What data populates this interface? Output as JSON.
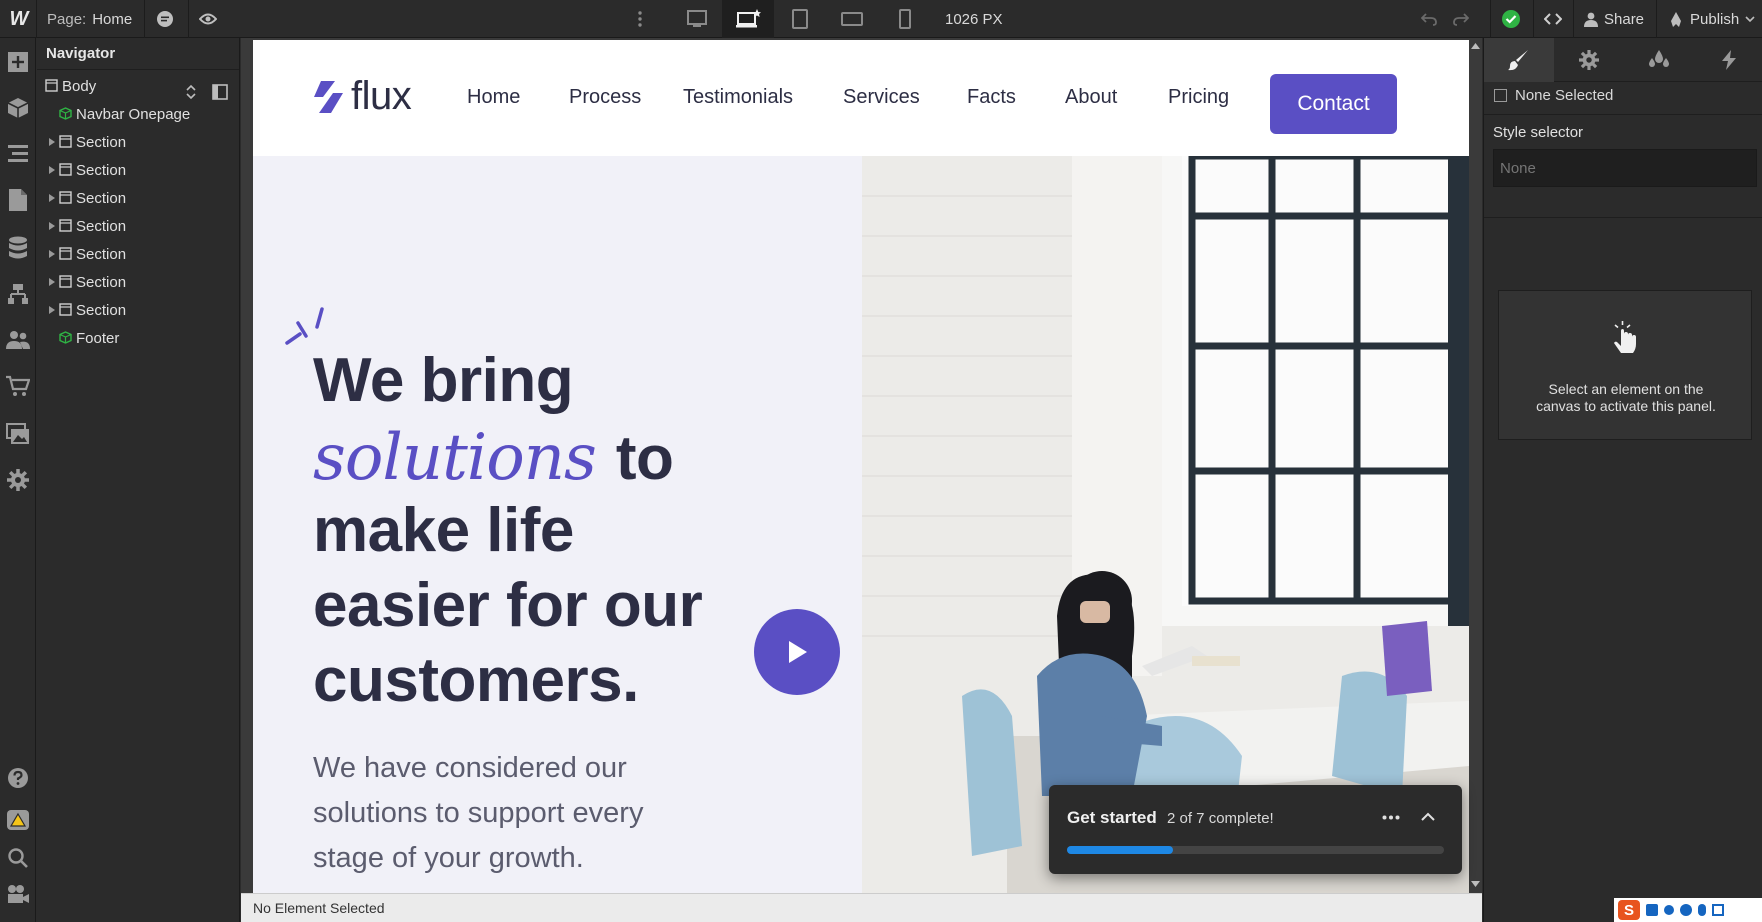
{
  "topbar": {
    "logo": "W",
    "page_label": "Page:",
    "page_name": "Home",
    "width_value": "1026 PX",
    "share_label": "Share",
    "publish_label": "Publish"
  },
  "navigator": {
    "title": "Navigator",
    "items": [
      {
        "label": "Body",
        "kind": "body"
      },
      {
        "label": "Navbar Onepage",
        "kind": "symbol"
      },
      {
        "label": "Section",
        "kind": "section"
      },
      {
        "label": "Section",
        "kind": "section"
      },
      {
        "label": "Section",
        "kind": "section"
      },
      {
        "label": "Section",
        "kind": "section"
      },
      {
        "label": "Section",
        "kind": "section"
      },
      {
        "label": "Section",
        "kind": "section"
      },
      {
        "label": "Section",
        "kind": "section"
      },
      {
        "label": "Footer",
        "kind": "symbol"
      }
    ]
  },
  "site": {
    "brand": "flux",
    "nav_links": [
      "Home",
      "Process",
      "Testimonials",
      "Services",
      "Facts",
      "About",
      "Pricing"
    ],
    "cta_label": "Contact",
    "hero_lines": [
      "We bring",
      "to",
      "make life",
      "easier for our",
      "customers."
    ],
    "hero_emphasis": "solutions",
    "hero_sub": [
      "We have considered our",
      "solutions to support every",
      "stage of your growth."
    ]
  },
  "getstarted": {
    "title": "Get started",
    "progress_text": "2 of 7 complete!",
    "progress_fraction": 0.28
  },
  "statusbar": {
    "text": "No Element Selected"
  },
  "rightpanel": {
    "none_selected": "None Selected",
    "selector_label": "Style selector",
    "selector_placeholder": "None",
    "hint_line1": "Select an element on the",
    "hint_line2": "canvas to activate this panel."
  },
  "colors": {
    "accent": "#5a4fc4",
    "dark_text": "#2d2e44",
    "hero_bg": "#f1f1f8",
    "success": "#2fb344",
    "progress": "#1e88e5"
  }
}
